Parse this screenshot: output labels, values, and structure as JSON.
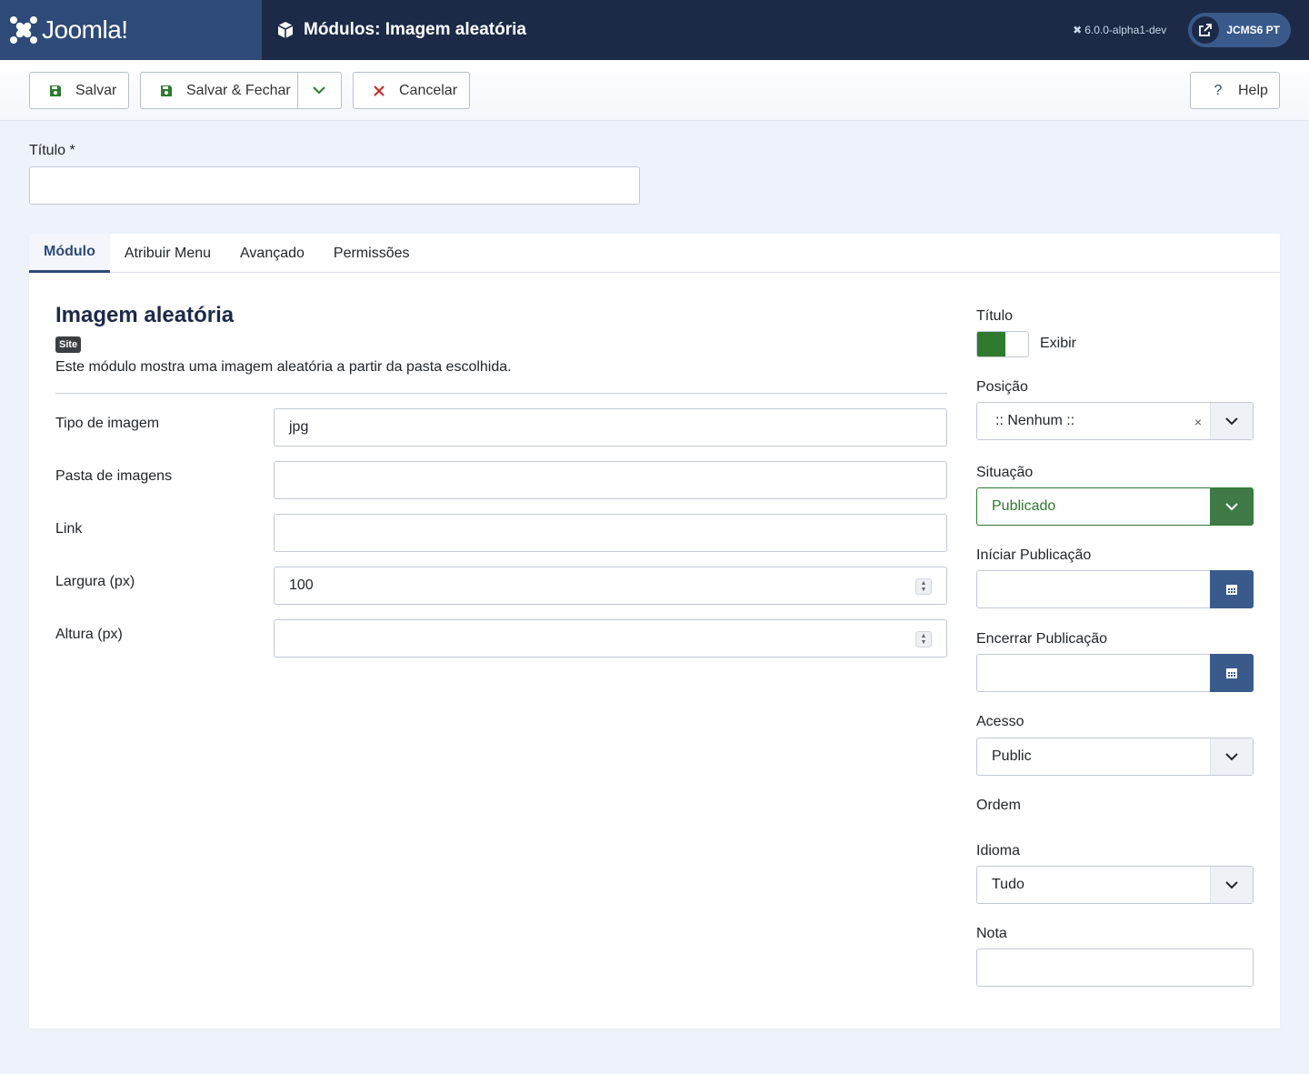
{
  "header": {
    "logo_text": "Joomla!",
    "page_title": "Módulos: Imagem aleatória",
    "version": "6.0.0-alpha1-dev",
    "user_label": "JCMS6 PT"
  },
  "toolbar": {
    "save_label": "Salvar",
    "save_close_label": "Salvar & Fechar",
    "cancel_label": "Cancelar",
    "help_label": "Help"
  },
  "title_field": {
    "label": "Título *",
    "value": ""
  },
  "tabs": [
    {
      "label": "Módulo"
    },
    {
      "label": "Atribuir Menu"
    },
    {
      "label": "Avançado"
    },
    {
      "label": "Permissões"
    }
  ],
  "module": {
    "name": "Imagem aleatória",
    "badge": "Site",
    "description": "Este módulo mostra uma imagem aleatória a partir da pasta escolhida."
  },
  "fields": {
    "image_type": {
      "label": "Tipo de imagem",
      "value": "jpg"
    },
    "image_folder": {
      "label": "Pasta de imagens",
      "value": ""
    },
    "link": {
      "label": "Link",
      "value": ""
    },
    "width": {
      "label": "Largura (px)",
      "value": "100"
    },
    "height": {
      "label": "Altura (px)",
      "value": ""
    }
  },
  "sidebar": {
    "show_title": {
      "label": "Título",
      "state": "Exibir"
    },
    "position": {
      "label": "Posição",
      "value": ":: Nenhum ::"
    },
    "status": {
      "label": "Situação",
      "value": "Publicado"
    },
    "publish_up": {
      "label": "Iníciar Publicação",
      "value": ""
    },
    "publish_down": {
      "label": "Encerrar Publicação",
      "value": ""
    },
    "access": {
      "label": "Acesso",
      "value": "Public"
    },
    "ordering": {
      "label": "Ordem"
    },
    "language": {
      "label": "Idioma",
      "value": "Tudo"
    },
    "note": {
      "label": "Nota",
      "value": ""
    }
  },
  "colors": {
    "header_bg": "#1c2a48",
    "logo_bg": "#2d4a78",
    "accent": "#2d4a78",
    "published_green": "#2e7a2f",
    "cancel_red": "#c52827",
    "save_green": "#2e7a2f"
  }
}
